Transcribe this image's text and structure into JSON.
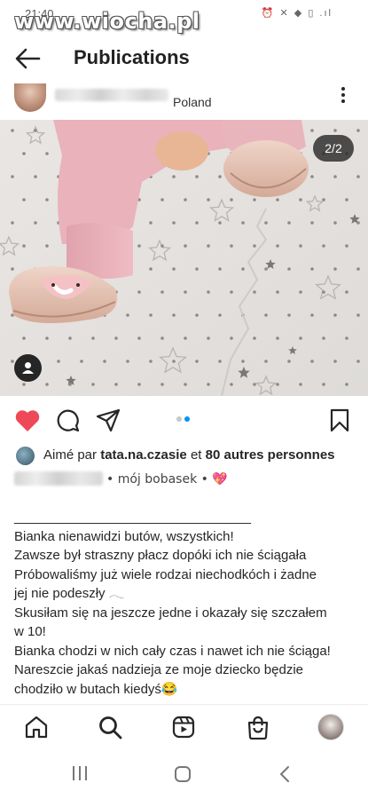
{
  "status_bar": {
    "time": "21:40",
    "icons": "⏰ ✕ ◆ ▯ .ıl"
  },
  "watermark": "www.wiocha.pl",
  "app_bar": {
    "title": "Publications"
  },
  "post": {
    "location": "Poland",
    "image_counter": "2/2",
    "carousel": {
      "count": 2,
      "active_index": 1
    },
    "likes": {
      "prefix": "Aimé par",
      "user": "tata.na.czasie",
      "middle": "et",
      "others": "80 autres personnes"
    },
    "caption_extra": "• mój bobasek • 💖",
    "caption_lines": [
      "________________________________",
      "Bianka nienawidzi butów, wszystkich!",
      "Zawsze był straszny płacz dopóki ich nie ściągała",
      "Próbowaliśmy już wiele rodzai niechodkóch i żadne",
      "jej nie podeszły 𓂃",
      "Skusiłam się na jeszcze jedne i okazały się szczałem",
      "w 10!",
      "Bianka chodzi w nich cały czas i nawet ich nie ściąga!",
      "Nareszcie jakaś nadzieja ze moje dziecko będzie",
      "chodziło w butach kiedyś😂"
    ]
  },
  "colors": {
    "heart": "#ed4956",
    "dot_active": "#0095f6",
    "dot_inactive": "#c7c7c7",
    "text": "#262626"
  },
  "icons": {
    "back": "arrow-left-icon",
    "more": "more-vertical-icon",
    "tag": "user-tag-icon",
    "like": "heart-icon",
    "comment": "comment-icon",
    "share": "send-icon",
    "save": "bookmark-icon",
    "home": "home-icon",
    "search": "search-icon",
    "reels": "reels-icon",
    "shop": "shop-icon",
    "recents": "recent-apps-icon",
    "home_sys": "home-circle-icon",
    "back_sys": "chevron-left-icon"
  }
}
